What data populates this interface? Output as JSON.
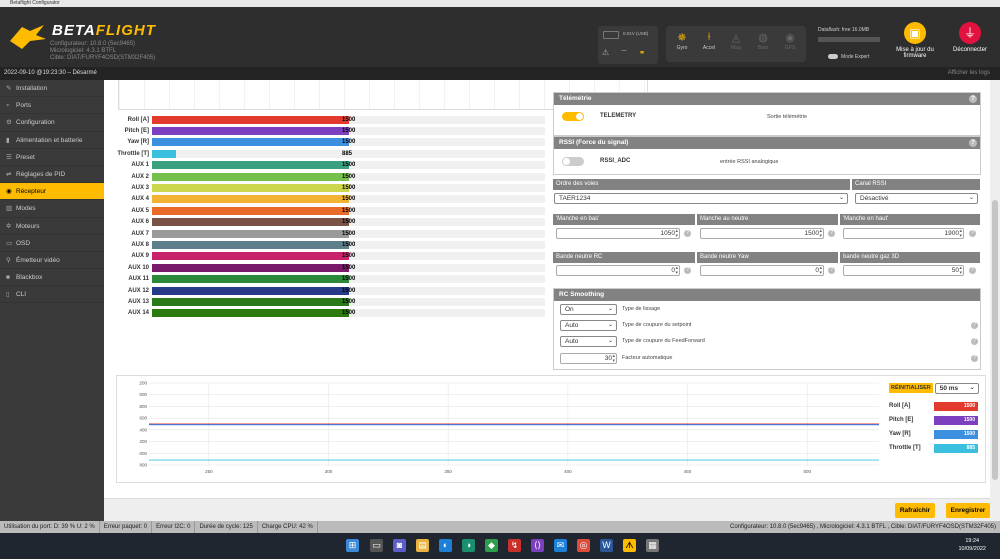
{
  "window_title": "Betaflight Configurator",
  "header": {
    "brand_a": "BETA",
    "brand_b": "FLIGHT",
    "versions": [
      "Configurateur: 10.8.0 (5ec9465)",
      "Micrologiciel: 4.3.1 BTFL",
      "Cible: DIAT/FURYF4OSD(STM32F405)"
    ],
    "battery": "0.01V (USB)",
    "sensors": [
      {
        "label": "Gyro",
        "icon": "gyro-icon",
        "active": true
      },
      {
        "label": "Accel",
        "icon": "accel-icon",
        "active": true
      },
      {
        "label": "Mag",
        "icon": "mag-icon",
        "active": false
      },
      {
        "label": "Baro",
        "icon": "baro-icon",
        "active": false
      },
      {
        "label": "GPS",
        "icon": "gps-icon",
        "active": false
      },
      {
        "label": "Sonar",
        "icon": "sonar-icon",
        "active": false
      }
    ],
    "dataflash": "Dataflash: free 16.0MB",
    "expert": "Mode Expert",
    "firmware": "Mise à jour du firmware",
    "disconnect": "Déconnecter"
  },
  "status": {
    "text": "2022-09-10 @19:23:30 – Désarmé",
    "logs": "Afficher les logs"
  },
  "sidebar": [
    {
      "label": "Installation",
      "icon": "wrench-icon"
    },
    {
      "label": "Ports",
      "icon": "plug-icon"
    },
    {
      "label": "Configuration",
      "icon": "gear-icon"
    },
    {
      "label": "Alimentation et batterie",
      "icon": "battery-icon"
    },
    {
      "label": "Preset",
      "icon": "preset-icon"
    },
    {
      "label": "Réglages de PID",
      "icon": "sliders-icon"
    },
    {
      "label": "Récepteur",
      "icon": "receiver-icon",
      "active": true
    },
    {
      "label": "Modes",
      "icon": "modes-icon"
    },
    {
      "label": "Moteurs",
      "icon": "motor-icon"
    },
    {
      "label": "OSD",
      "icon": "osd-icon"
    },
    {
      "label": "Émetteur vidéo",
      "icon": "vtx-icon"
    },
    {
      "label": "Blackbox",
      "icon": "blackbox-icon"
    },
    {
      "label": "CLI",
      "icon": "cli-icon"
    }
  ],
  "channels": [
    {
      "name": "Roll [A]",
      "value": 1500,
      "color": "#e23b2e"
    },
    {
      "name": "Pitch [E]",
      "value": 1500,
      "color": "#7b3fbf"
    },
    {
      "name": "Yaw [R]",
      "value": 1500,
      "color": "#3d8fe0"
    },
    {
      "name": "Throttle [T]",
      "value": 885,
      "color": "#3ac0de"
    },
    {
      "name": "AUX 1",
      "value": 1500,
      "color": "#3aa080"
    },
    {
      "name": "AUX 2",
      "value": 1500,
      "color": "#75c04a"
    },
    {
      "name": "AUX 3",
      "value": 1500,
      "color": "#cbd64a"
    },
    {
      "name": "AUX 4",
      "value": 1500,
      "color": "#f3b332"
    },
    {
      "name": "AUX 5",
      "value": 1500,
      "color": "#ea6a2a"
    },
    {
      "name": "AUX 6",
      "value": 1500,
      "color": "#7a5345"
    },
    {
      "name": "AUX 7",
      "value": 1500,
      "color": "#9a9a9a"
    },
    {
      "name": "AUX 8",
      "value": 1500,
      "color": "#5f7e8c"
    },
    {
      "name": "AUX 9",
      "value": 1500,
      "color": "#c8226a"
    },
    {
      "name": "AUX 10",
      "value": 1500,
      "color": "#7a1a6a"
    },
    {
      "name": "AUX 11",
      "value": 1500,
      "color": "#2a8a3a"
    },
    {
      "name": "AUX 12",
      "value": 1500,
      "color": "#283a8a"
    },
    {
      "name": "AUX 13",
      "value": 1500,
      "color": "#2a7a1a"
    },
    {
      "name": "AUX 14",
      "value": 1500,
      "color": "#2a7a10"
    }
  ],
  "telemetry": {
    "title": "Télémétrie",
    "label": "TELEMETRY",
    "desc": "Sortie télémétrie"
  },
  "rssi": {
    "title": "RSSI (Force du signal)",
    "label": "RSSI_ADC",
    "desc": "entrée RSSI analogique"
  },
  "channel_map": {
    "header": "Ordre des voies",
    "value": "TAER1234",
    "rssi_header": "Canal RSSI",
    "rssi_value": "Désactivé"
  },
  "sticks": {
    "low_h": "'Manche en bas'",
    "low": "1050",
    "center_h": "Manche au neutre",
    "center": "1500",
    "high_h": "'Manche en haut'",
    "high": "1900"
  },
  "deadband": {
    "rc_h": "Bande neutre RC",
    "rc": "0",
    "yaw_h": "Bande neutre Yaw",
    "yaw": "0",
    "thr_h": "bande neutre gaz 3D",
    "thr": "50"
  },
  "smoothing": {
    "title": "RC Smoothing",
    "type": "On",
    "type_desc": "Type de lissage",
    "setpoint": "Auto",
    "setpoint_desc": "Type de coupure du setpoint",
    "ff": "Auto",
    "ff_desc": "Type de coupure du FeedForward",
    "factor": "30",
    "factor_desc": "Facteur automatique"
  },
  "chart_data": {
    "type": "line",
    "y_ticks": [
      2200,
      2000,
      1800,
      1600,
      1400,
      1200,
      1000,
      800
    ],
    "x_ticks": [
      250,
      300,
      350,
      400,
      450,
      500
    ],
    "ylim": [
      800,
      2200
    ],
    "xlim": [
      225,
      530
    ],
    "series": [
      {
        "name": "Roll [A]",
        "value": 1500,
        "color": "#e23b2e"
      },
      {
        "name": "Pitch [E]",
        "value": 1500,
        "color": "#7b3fbf"
      },
      {
        "name": "Yaw [R]",
        "value": 1500,
        "color": "#3d8fe0"
      },
      {
        "name": "Throttle [T]",
        "value": 885,
        "color": "#3ac0de"
      }
    ]
  },
  "graph_controls": {
    "reset": "RÉINITIALISER",
    "interval": "50 ms"
  },
  "buttons": {
    "refresh": "Rafraîchir",
    "save": "Enregistrer"
  },
  "statusbar": {
    "port": "Utilisation du port: D: 39 % U: 2 %",
    "packet": "Erreur paquet: 0",
    "i2c": "Erreur I2C: 0",
    "cycle": "Durée de cycle: 125",
    "cpu": "Charge CPU: 42 %",
    "config": "Configurateur: 10.8.0 (5ec9465) , Micrologiciel: 4.3.1 BTFL , Cible: DIAT/FURYF4OSD(STM32F405)"
  },
  "taskbar": {
    "time": "19:24",
    "date": "10/09/2022"
  }
}
